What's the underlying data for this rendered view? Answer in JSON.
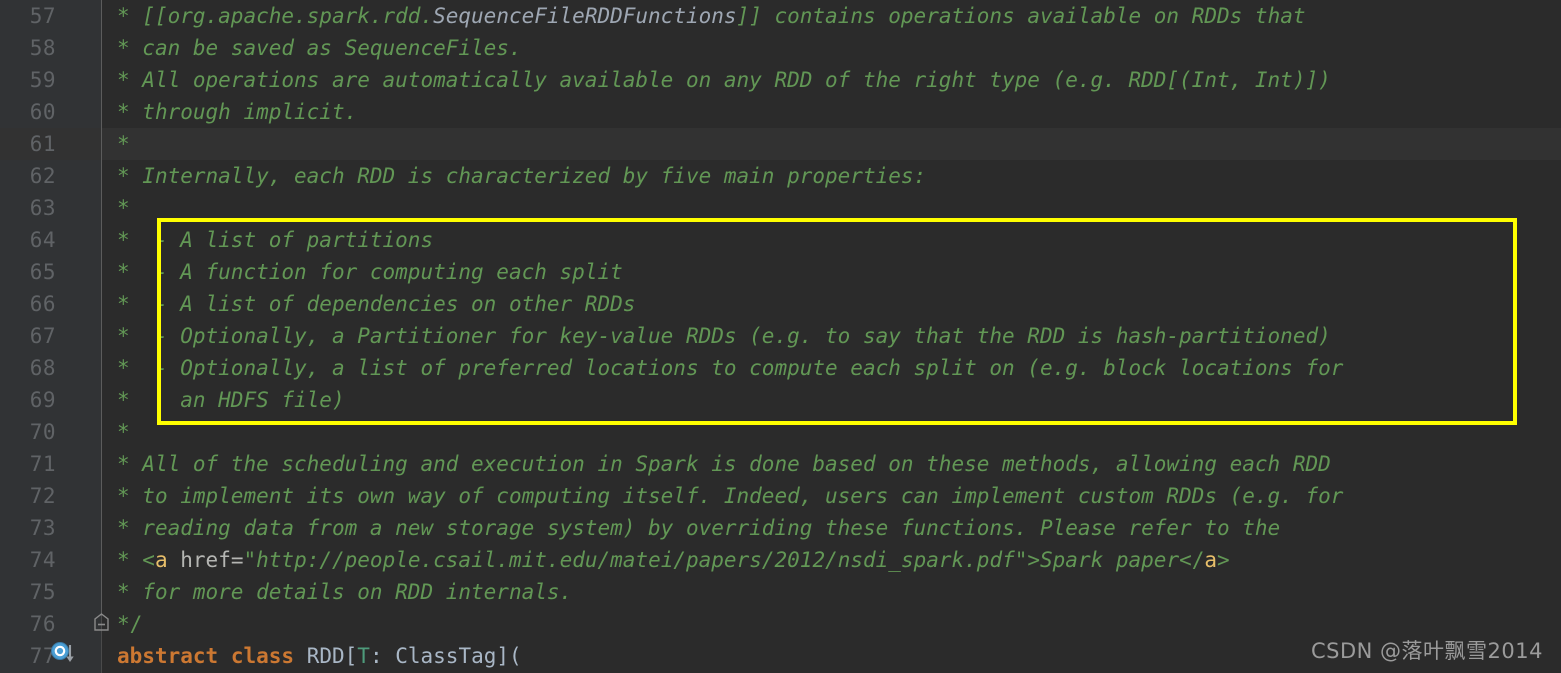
{
  "editor": {
    "theme_name": "Darcula",
    "background": "#2b2b2b",
    "current_line_background": "#323232",
    "gutter_background": "#313335",
    "line_number_color": "#606366",
    "comment_color": "#629755",
    "keyword_color": "#cc7832",
    "identifier_color": "#a9b7c6",
    "highlight_box_color": "#ffff00",
    "first_line_number": 57,
    "last_line_number": 77,
    "current_line_number": 61
  },
  "lines": [
    {
      "num": "57",
      "text": "* [[org.apache.spark.rdd.SequenceFileRDDFunctions]] contains operations available on RDDs that"
    },
    {
      "num": "58",
      "text": "* can be saved as SequenceFiles."
    },
    {
      "num": "59",
      "text": "* All operations are automatically available on any RDD of the right type (e.g. RDD[(Int, Int)])"
    },
    {
      "num": "60",
      "text": "* through implicit."
    },
    {
      "num": "61",
      "text": "*"
    },
    {
      "num": "62",
      "text": "* Internally, each RDD is characterized by five main properties:"
    },
    {
      "num": "63",
      "text": "*"
    },
    {
      "num": "64",
      "text": "*  - A list of partitions"
    },
    {
      "num": "65",
      "text": "*  - A function for computing each split"
    },
    {
      "num": "66",
      "text": "*  - A list of dependencies on other RDDs"
    },
    {
      "num": "67",
      "text": "*  - Optionally, a Partitioner for key-value RDDs (e.g. to say that the RDD is hash-partitioned)"
    },
    {
      "num": "68",
      "text": "*  - Optionally, a list of preferred locations to compute each split on (e.g. block locations for"
    },
    {
      "num": "69",
      "text": "*    an HDFS file)"
    },
    {
      "num": "70",
      "text": "*"
    },
    {
      "num": "71",
      "text": "* All of the scheduling and execution in Spark is done based on these methods, allowing each RDD"
    },
    {
      "num": "72",
      "text": "* to implement its own way of computing itself. Indeed, users can implement custom RDDs (e.g. for"
    },
    {
      "num": "73",
      "text": "* reading data from a new storage system) by overriding these functions. Please refer to the"
    },
    {
      "num": "74",
      "text": "* <a href=\"http://people.csail.mit.edu/matei/papers/2012/nsdi_spark.pdf\">Spark paper</a>"
    },
    {
      "num": "75",
      "text": "* for more details on RDD internals."
    },
    {
      "num": "76",
      "text": "*/"
    },
    {
      "num": "77",
      "text": "abstract class RDD[T: ClassTag]("
    }
  ],
  "tokens": {
    "l57": {
      "star": "* ",
      "open": "[[",
      "pkg": "org.apache.spark.rdd.",
      "link": "SequenceFileRDDFunctions",
      "close": "]] ",
      "rest": "contains operations available on RDDs that"
    },
    "l58": {
      "star": "* ",
      "rest": "can be saved as SequenceFiles."
    },
    "l59": {
      "star": "* ",
      "rest": "All operations are automatically available on any RDD of the right type (e.g. RDD[(Int, Int)])"
    },
    "l60": {
      "star": "* ",
      "rest": "through implicit."
    },
    "l61": {
      "star": "*"
    },
    "l62": {
      "star": "* ",
      "rest": "Internally, each RDD is characterized by five main properties:"
    },
    "l63": {
      "star": "*"
    },
    "l64": {
      "star": "* ",
      "rest": " - A list of partitions"
    },
    "l65": {
      "star": "* ",
      "rest": " - A function for computing each split"
    },
    "l66": {
      "star": "* ",
      "rest": " - A list of dependencies on other RDDs"
    },
    "l67": {
      "star": "* ",
      "rest": " - Optionally, a Partitioner for key-value RDDs (e.g. to say that the RDD is hash-partitioned)"
    },
    "l68": {
      "star": "* ",
      "rest": " - Optionally, a list of preferred locations to compute each split on (e.g. block locations for"
    },
    "l69": {
      "star": "* ",
      "rest": "   an HDFS file)"
    },
    "l70": {
      "star": "*"
    },
    "l71": {
      "star": "* ",
      "rest": "All of the scheduling and execution in Spark is done based on these methods, allowing each RDD"
    },
    "l72": {
      "star": "* ",
      "rest": "to implement its own way of computing itself. Indeed, users can implement custom RDDs (e.g. for"
    },
    "l73": {
      "star": "* ",
      "rest": "reading data from a new storage system) by overriding these functions. Please refer to the"
    },
    "l74": {
      "star": "* ",
      "lt": "<",
      "tagname": "a",
      "space": " ",
      "attr": "href",
      "eq": "=",
      "url": "\"http://people.csail.mit.edu/matei/papers/2012/nsdi_spark.pdf\">",
      "linktext": "Spark paper",
      "closelt": "</",
      "closetag": "a",
      "gt": ">"
    },
    "l75": {
      "star": "* ",
      "rest": "for more details on RDD internals."
    },
    "l76": {
      "star": "*/"
    },
    "l77": {
      "kw1": "abstract",
      "sp1": " ",
      "kw2": "class",
      "sp2": " ",
      "cls": "RDD",
      "br1": "[",
      "tp": "T",
      "colon": ": ",
      "tag": "ClassTag",
      "br2": "]("
    }
  },
  "gutter_icons": {
    "fold_marker": "fold-collapse-icon",
    "override_marker": "override-implemented-icon",
    "override_marker_tooltip": "O"
  },
  "annotation": {
    "type": "highlight-rectangle",
    "color": "#ffff00",
    "covers_lines": "64-69",
    "content": "- A list of partitions / - A function for computing each split / - A list of dependencies on other RDDs / - Optionally, a Partitioner for key-value RDDs (e.g. to say that the RDD is hash-partitioned) / - Optionally, a list of preferred locations to compute each split on (e.g. block locations for an HDFS file)"
  },
  "watermark": {
    "text": "CSDN @落叶飘雪2014"
  }
}
